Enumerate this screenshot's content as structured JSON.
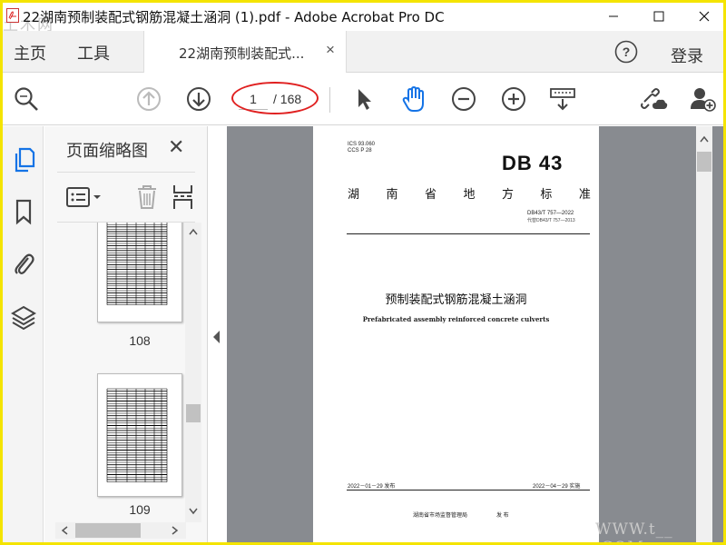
{
  "window": {
    "title": "22湖南预制装配式钢筋混凝土涵洞 (1).pdf - Adobe Acrobat Pro DC",
    "watermark_top": "土木网",
    "watermark_bottom": "WWW.t__ .COM"
  },
  "menu": {
    "home": "主页",
    "tools": "工具",
    "doc_tab": "22湖南预制装配式...",
    "login": "登录"
  },
  "toolbar": {
    "current_page": "1",
    "total_pages": "/ 168"
  },
  "thumbnails": {
    "panel_title": "页面缩略图",
    "items": [
      {
        "page": "108"
      },
      {
        "page": "109"
      }
    ]
  },
  "document": {
    "ics": "ICS 93.060",
    "ccs": "CCS P 28",
    "db_label": "DB 43",
    "province_chars": [
      "湖",
      "南",
      "省",
      "地",
      "方",
      "标",
      "准"
    ],
    "std_no": "DB43/T 757—2022",
    "replaces": "代替DB43/T 757—2013",
    "title_cn": "预制装配式钢筋混凝土涵洞",
    "title_en": "Prefabricated assembly reinforced concrete culverts",
    "release_date": "2022－01－29 发布",
    "implement_date": "2022－04－29 实施",
    "issuer": "湖南省市场监督管理局",
    "issue_word": "发 布"
  },
  "colors": {
    "accent": "#1473e6",
    "annotation": "#e02020",
    "doc_bg": "#888b90",
    "frame": "#f4e400"
  }
}
